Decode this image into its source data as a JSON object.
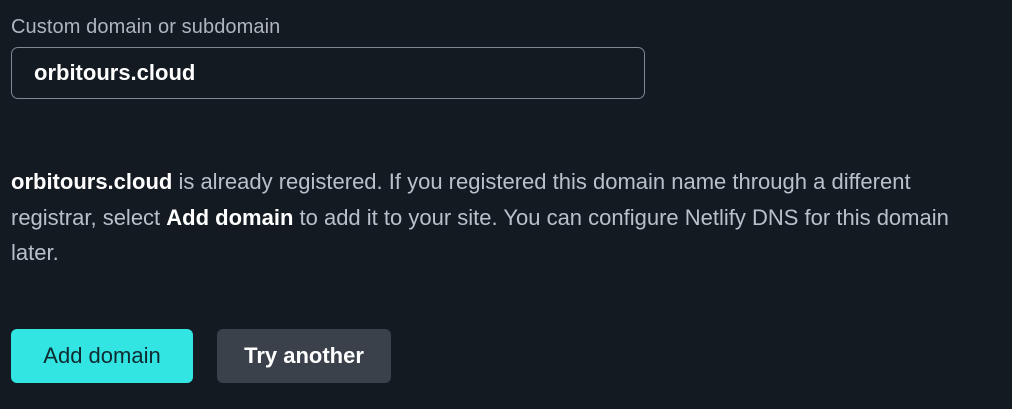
{
  "form": {
    "field_label": "Custom domain or subdomain",
    "domain_value": "orbitours.cloud"
  },
  "message": {
    "domain": "orbitours.cloud",
    "text_1": " is already registered. If you registered this domain name through a different registrar, select ",
    "action_name": "Add domain",
    "text_2": " to add it to your site. You can configure Netlify DNS for this domain later."
  },
  "actions": {
    "add_domain_label": "Add domain",
    "try_another_label": "Try another"
  },
  "colors": {
    "background": "#141a22",
    "primary_button": "#32e5e2",
    "secondary_button": "#3a414b"
  }
}
